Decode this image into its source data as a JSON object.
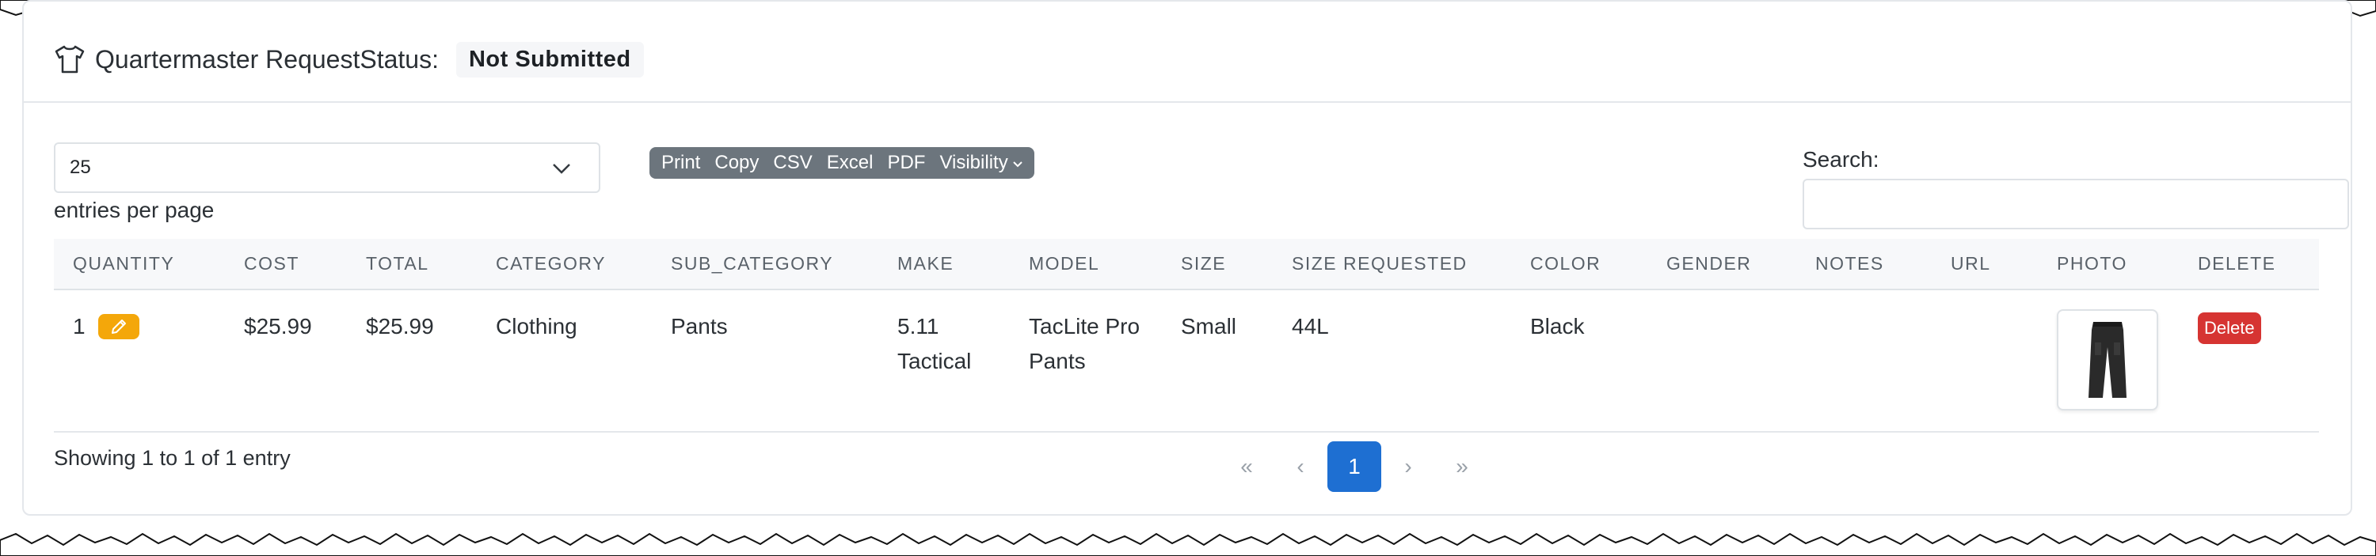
{
  "header": {
    "title": "Quartermaster RequestStatus:",
    "status": "Not Submitted",
    "icon": "tshirt-icon"
  },
  "length_menu": {
    "value": "25",
    "label": "entries per page"
  },
  "buttons": [
    "Print",
    "Copy",
    "CSV",
    "Excel",
    "PDF",
    "Visibility"
  ],
  "search": {
    "label": "Search:",
    "value": ""
  },
  "table": {
    "columns": [
      "QUANTITY",
      "COST",
      "TOTAL",
      "CATEGORY",
      "SUB_CATEGORY",
      "MAKE",
      "MODEL",
      "SIZE",
      "SIZE REQUESTED",
      "COLOR",
      "GENDER",
      "NOTES",
      "URL",
      "PHOTO",
      "DELETE"
    ],
    "rows": [
      {
        "quantity": "1",
        "cost": "$25.99",
        "total": "$25.99",
        "category": "Clothing",
        "sub_category": "Pants",
        "make_line1": "5.11",
        "make_line2": "Tactical",
        "model_line1": "TacLite Pro",
        "model_line2": "Pants",
        "size": "Small",
        "size_requested": "44L",
        "color": "Black",
        "gender": "",
        "notes": "",
        "url": "",
        "photo": "black-pants-photo",
        "delete_label": "Delete"
      }
    ]
  },
  "footer": {
    "info": "Showing 1 to 1 of 1 entry",
    "pager": {
      "first": "«",
      "prev": "‹",
      "current": "1",
      "next": "›",
      "last": "»"
    }
  },
  "colors": {
    "edit_button": "#f4a70a",
    "delete_button": "#d63432",
    "active_page": "#1e6fd2",
    "button_group": "#6c757d"
  }
}
